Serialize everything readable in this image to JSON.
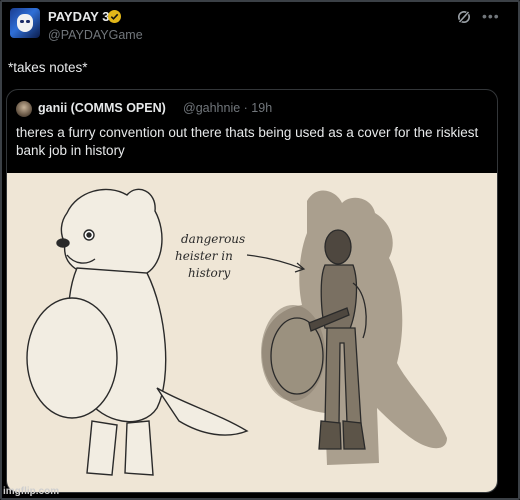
{
  "author": {
    "display_name": "PAYDAY 3",
    "handle": "@PAYDAYGame"
  },
  "post": {
    "text": "*takes notes*"
  },
  "quoted_post": {
    "author_name": "ganii (COMMS OPEN)",
    "handle_time": "@gahhnie · 19h",
    "text": "theres a furry convention out there thats being used as a cover for the riskiest bank job in history",
    "image": {
      "annotation_line1": "dangerous",
      "annotation_line2": "heister in",
      "annotation_line3": "history"
    }
  },
  "icons": {
    "verified": "verified-badge-icon",
    "grok": "grok-icon",
    "more": "more-options-icon"
  },
  "watermark": "imgflip.com",
  "colors": {
    "background": "#000000",
    "text": "#e7e9ea",
    "muted": "#71767b",
    "verified": "#e2b719",
    "art_background": "#efe6d6"
  }
}
